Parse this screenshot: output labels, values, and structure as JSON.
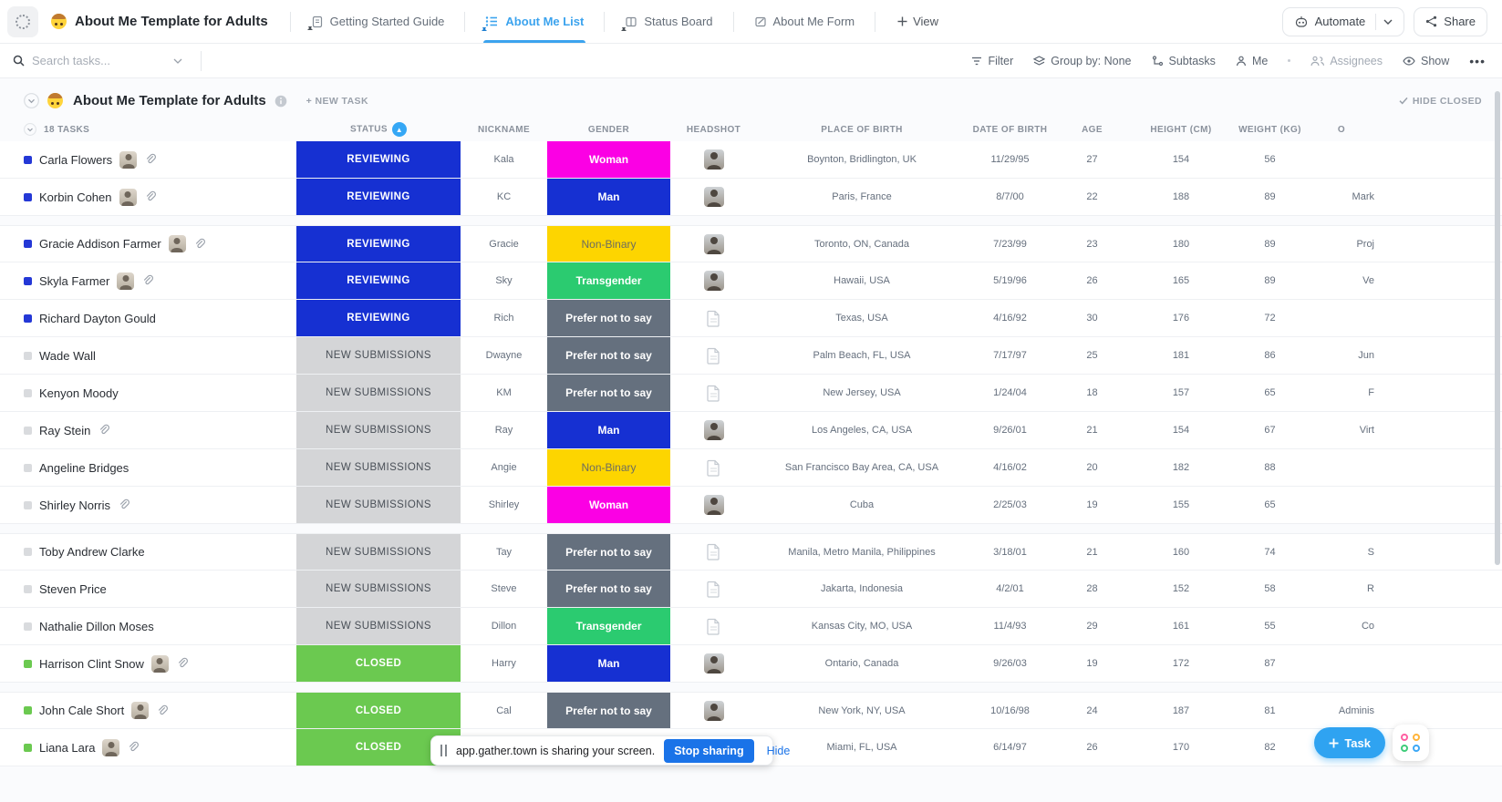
{
  "topbar": {
    "title": "About Me Template for Adults",
    "tabs": [
      {
        "label": "Getting Started Guide"
      },
      {
        "label": "About Me List"
      },
      {
        "label": "Status Board"
      },
      {
        "label": "About Me Form"
      }
    ],
    "add_view_label": "View",
    "automate_label": "Automate",
    "share_label": "Share"
  },
  "toolbar": {
    "search_placeholder": "Search tasks...",
    "filter_label": "Filter",
    "group_by_label": "Group by: None",
    "subtasks_label": "Subtasks",
    "me_label": "Me",
    "assignees_label": "Assignees",
    "show_label": "Show",
    "more_label": "•••"
  },
  "section": {
    "title": "About Me Template for Adults",
    "new_task_label": "+ NEW TASK",
    "hide_closed_label": "HIDE CLOSED",
    "task_count_label": "18 TASKS"
  },
  "table": {
    "columns": {
      "status": "STATUS",
      "nickname": "NICKNAME",
      "gender": "GENDER",
      "headshot": "HEADSHOT",
      "place": "PLACE OF BIRTH",
      "dob": "DATE OF BIRTH",
      "age": "AGE",
      "height": "HEIGHT (CM)",
      "weight": "WEIGHT (KG)",
      "occupation": "O"
    },
    "rows": [
      {
        "name": "Carla Flowers",
        "avatar": true,
        "clip": true,
        "status": "REVIEWING",
        "status_type": "reviewing",
        "nickname": "Kala",
        "gender": "Woman",
        "gender_type": "woman",
        "headshot": "photo",
        "place": "Boynton, Bridlington, UK",
        "dob": "11/29/95",
        "age": "27",
        "height": "154",
        "weight": "56",
        "occupation": "",
        "gap": false
      },
      {
        "name": "Korbin Cohen",
        "avatar": true,
        "clip": true,
        "status": "REVIEWING",
        "status_type": "reviewing",
        "nickname": "KC",
        "gender": "Man",
        "gender_type": "man",
        "headshot": "photo",
        "place": "Paris, France",
        "dob": "8/7/00",
        "age": "22",
        "height": "188",
        "weight": "89",
        "occupation": "Mark",
        "gap": false
      },
      {
        "name": "Gracie Addison Farmer",
        "avatar": true,
        "clip": true,
        "status": "REVIEWING",
        "status_type": "reviewing",
        "nickname": "Gracie",
        "gender": "Non-Binary",
        "gender_type": "nonbinary",
        "headshot": "photo",
        "place": "Toronto, ON, Canada",
        "dob": "7/23/99",
        "age": "23",
        "height": "180",
        "weight": "89",
        "occupation": "Proj",
        "gap": true
      },
      {
        "name": "Skyla Farmer",
        "avatar": true,
        "clip": true,
        "status": "REVIEWING",
        "status_type": "reviewing",
        "nickname": "Sky",
        "gender": "Transgender",
        "gender_type": "trans",
        "headshot": "photo",
        "place": "Hawaii, USA",
        "dob": "5/19/96",
        "age": "26",
        "height": "165",
        "weight": "89",
        "occupation": "Ve",
        "gap": false
      },
      {
        "name": "Richard Dayton Gould",
        "avatar": false,
        "clip": false,
        "status": "REVIEWING",
        "status_type": "reviewing",
        "nickname": "Rich",
        "gender": "Prefer not to say",
        "gender_type": "pnts",
        "headshot": "doc",
        "place": "Texas, USA",
        "dob": "4/16/92",
        "age": "30",
        "height": "176",
        "weight": "72",
        "occupation": "",
        "gap": false
      },
      {
        "name": "Wade Wall",
        "avatar": false,
        "clip": false,
        "status": "NEW SUBMISSIONS",
        "status_type": "new",
        "nickname": "Dwayne",
        "gender": "Prefer not to say",
        "gender_type": "pnts",
        "headshot": "doc",
        "place": "Palm Beach, FL, USA",
        "dob": "7/17/97",
        "age": "25",
        "height": "181",
        "weight": "86",
        "occupation": "Jun",
        "gap": false
      },
      {
        "name": "Kenyon Moody",
        "avatar": false,
        "clip": false,
        "status": "NEW SUBMISSIONS",
        "status_type": "new",
        "nickname": "KM",
        "gender": "Prefer not to say",
        "gender_type": "pnts",
        "headshot": "doc",
        "place": "New Jersey, USA",
        "dob": "1/24/04",
        "age": "18",
        "height": "157",
        "weight": "65",
        "occupation": "F",
        "gap": false
      },
      {
        "name": "Ray Stein",
        "avatar": false,
        "clip": true,
        "status": "NEW SUBMISSIONS",
        "status_type": "new",
        "nickname": "Ray",
        "gender": "Man",
        "gender_type": "man",
        "headshot": "photo",
        "place": "Los Angeles, CA, USA",
        "dob": "9/26/01",
        "age": "21",
        "height": "154",
        "weight": "67",
        "occupation": "Virt",
        "gap": false
      },
      {
        "name": "Angeline Bridges",
        "avatar": false,
        "clip": false,
        "status": "NEW SUBMISSIONS",
        "status_type": "new",
        "nickname": "Angie",
        "gender": "Non-Binary",
        "gender_type": "nonbinary",
        "headshot": "doc",
        "place": "San Francisco Bay Area, CA, USA",
        "dob": "4/16/02",
        "age": "20",
        "height": "182",
        "weight": "88",
        "occupation": "",
        "gap": false
      },
      {
        "name": "Shirley Norris",
        "avatar": false,
        "clip": true,
        "status": "NEW SUBMISSIONS",
        "status_type": "new",
        "nickname": "Shirley",
        "gender": "Woman",
        "gender_type": "woman",
        "headshot": "photo",
        "place": "Cuba",
        "dob": "2/25/03",
        "age": "19",
        "height": "155",
        "weight": "65",
        "occupation": "",
        "gap": false
      },
      {
        "name": "Toby Andrew Clarke",
        "avatar": false,
        "clip": false,
        "status": "NEW SUBMISSIONS",
        "status_type": "new",
        "nickname": "Tay",
        "gender": "Prefer not to say",
        "gender_type": "pnts",
        "headshot": "doc",
        "place": "Manila, Metro Manila, Philippines",
        "dob": "3/18/01",
        "age": "21",
        "height": "160",
        "weight": "74",
        "occupation": "S",
        "gap": true
      },
      {
        "name": "Steven Price",
        "avatar": false,
        "clip": false,
        "status": "NEW SUBMISSIONS",
        "status_type": "new",
        "nickname": "Steve",
        "gender": "Prefer not to say",
        "gender_type": "pnts",
        "headshot": "doc",
        "place": "Jakarta, Indonesia",
        "dob": "4/2/01",
        "age": "28",
        "height": "152",
        "weight": "58",
        "occupation": "R",
        "gap": false
      },
      {
        "name": "Nathalie Dillon Moses",
        "avatar": false,
        "clip": false,
        "status": "NEW SUBMISSIONS",
        "status_type": "new",
        "nickname": "Dillon",
        "gender": "Transgender",
        "gender_type": "trans",
        "headshot": "doc",
        "place": "Kansas City, MO, USA",
        "dob": "11/4/93",
        "age": "29",
        "height": "161",
        "weight": "55",
        "occupation": "Co",
        "gap": false
      },
      {
        "name": "Harrison Clint Snow",
        "avatar": true,
        "clip": true,
        "status": "CLOSED",
        "status_type": "closed",
        "nickname": "Harry",
        "gender": "Man",
        "gender_type": "man",
        "headshot": "photo",
        "place": "Ontario, Canada",
        "dob": "9/26/03",
        "age": "19",
        "height": "172",
        "weight": "87",
        "occupation": "",
        "gap": false
      },
      {
        "name": "John Cale Short",
        "avatar": true,
        "clip": true,
        "status": "CLOSED",
        "status_type": "closed",
        "nickname": "Cal",
        "gender": "Prefer not to say",
        "gender_type": "pnts",
        "headshot": "photo",
        "place": "New York, NY, USA",
        "dob": "10/16/98",
        "age": "24",
        "height": "187",
        "weight": "81",
        "occupation": "Adminis",
        "gap": true
      },
      {
        "name": "Liana Lara",
        "avatar": true,
        "clip": true,
        "status": "CLOSED",
        "status_type": "closed",
        "nickname": "",
        "gender": "",
        "gender_type": "",
        "headshot": "photo",
        "place": "Miami, FL, USA",
        "dob": "6/14/97",
        "age": "26",
        "height": "170",
        "weight": "82",
        "occupation": "",
        "gap": false
      }
    ]
  },
  "colors": {
    "accent_blue": "#3ba3ee",
    "status_reviewing": "#1630d2",
    "status_new": "#d4d5d7",
    "status_closed": "#6bc950",
    "gender_woman": "#fb00e4",
    "gender_man": "#1630d2",
    "gender_nonbinary": "#fdd500",
    "gender_transgender": "#2bcb70",
    "gender_pnts": "#65707e"
  },
  "notification": {
    "text": "app.gather.town is sharing your screen.",
    "stop_label": "Stop sharing",
    "hide_label": "Hide"
  },
  "fab": {
    "task_label": "Task"
  }
}
